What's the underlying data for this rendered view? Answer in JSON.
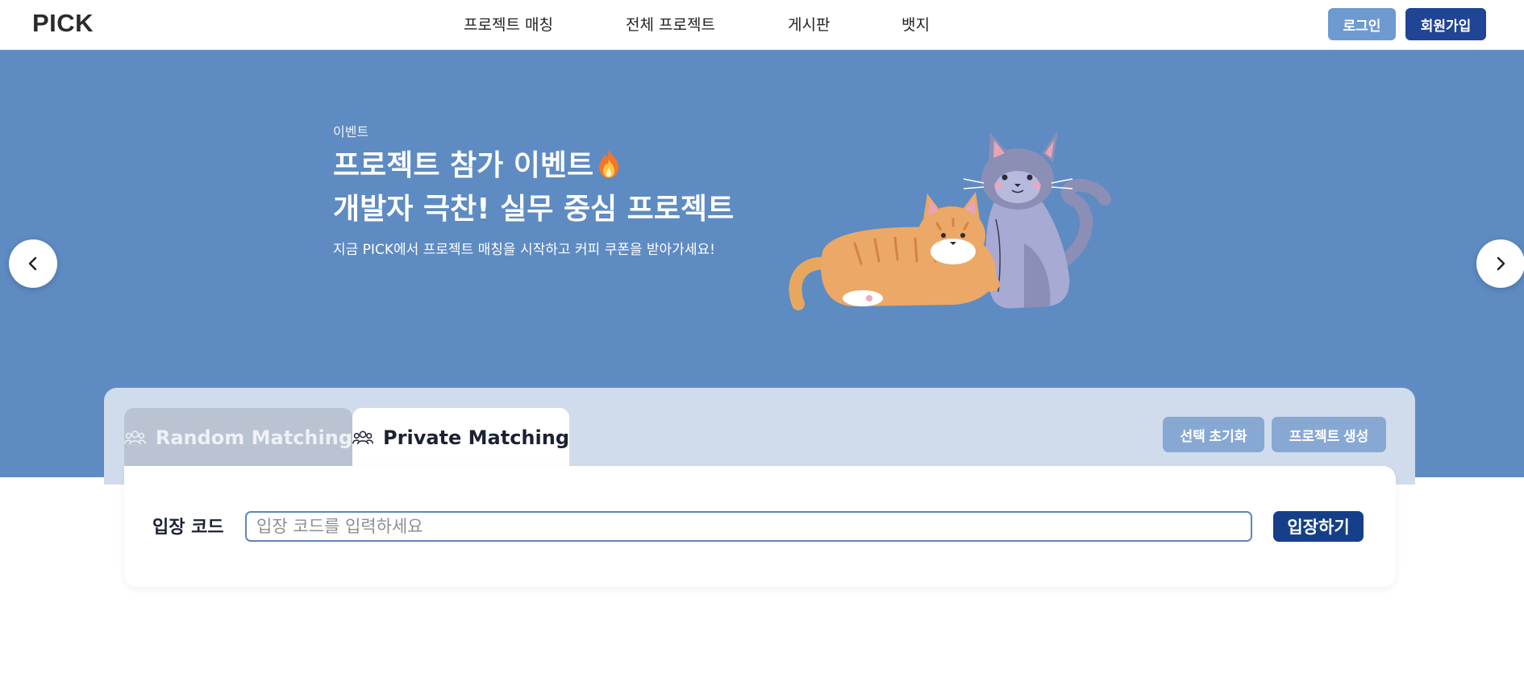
{
  "header": {
    "logo": "PICK",
    "nav": [
      "프로젝트 매칭",
      "전체 프로젝트",
      "게시판",
      "뱃지"
    ],
    "login_label": "로그인",
    "signup_label": "회원가입"
  },
  "hero": {
    "eyebrow": "이벤트",
    "title_line1": "프로젝트 참가 이벤트",
    "title_line2": "개발자 극찬! 실무 중심 프로젝트",
    "description": "지금 PICK에서 프로젝트 매칭을 시작하고 커피 쿠폰을 받아가세요!"
  },
  "matching": {
    "tabs": [
      {
        "label": "Random Matching",
        "active": false
      },
      {
        "label": "Private Matching",
        "active": true
      }
    ],
    "reset_label": "선택 초기화",
    "create_label": "프로젝트 생성",
    "code_label": "입장 코드",
    "code_placeholder": "입장 코드를 입력하세요",
    "enter_label": "입장하기"
  },
  "colors": {
    "hero_bg": "#5e8bc2",
    "brand_dark": "#1f4594",
    "accent_light": "#6e9ad1"
  }
}
